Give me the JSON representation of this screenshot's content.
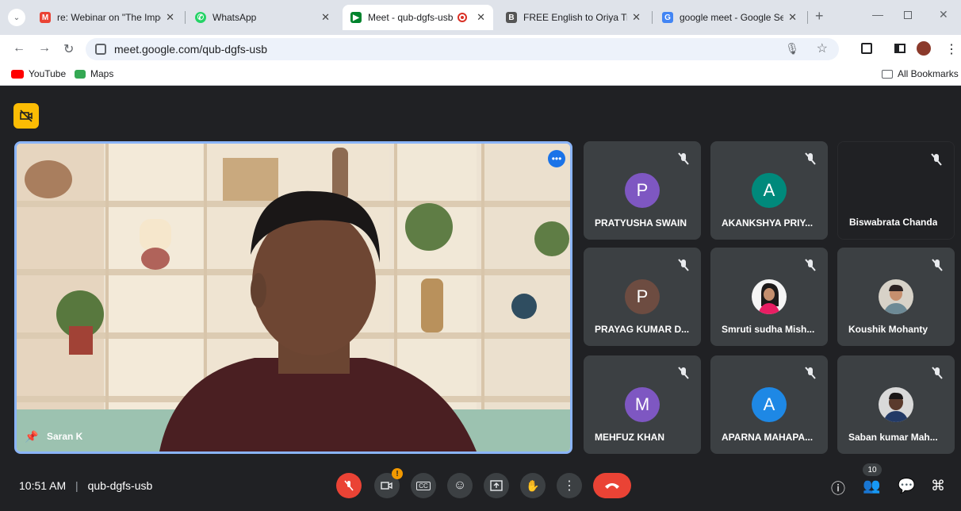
{
  "browser": {
    "tabs": [
      {
        "label": "re: Webinar on \"The Import",
        "color": "#ea4335",
        "glyph": "M"
      },
      {
        "label": "WhatsApp",
        "color": "#25d366",
        "glyph": "✆"
      },
      {
        "label": "Meet - qub-dgfs-usb",
        "color": "#00832d",
        "glyph": "▶"
      },
      {
        "label": "FREE English to Oriya Transl",
        "color": "#555555",
        "glyph": "B"
      },
      {
        "label": "google meet - Google Sear",
        "color": "#4285f4",
        "glyph": "G"
      }
    ],
    "url": "meet.google.com/qub-dgfs-usb",
    "bookmarks": [
      {
        "label": "YouTube",
        "color": "#ff0000"
      },
      {
        "label": "Maps",
        "color": "#34a853"
      }
    ],
    "all_bookmarks": "All Bookmarks"
  },
  "meeting": {
    "presenter_name": "Saran K",
    "time": "10:51 AM",
    "code": "qub-dgfs-usb",
    "participant_count": "10",
    "participants": [
      {
        "name": "PRATYUSHA SWAIN",
        "initial": "P",
        "color": "#7e57c2"
      },
      {
        "name": "AKANKSHYA PRIY...",
        "initial": "A",
        "color": "#00897b"
      },
      {
        "name": "Biswabrata Chanda",
        "initial": "",
        "color": ""
      },
      {
        "name": "PRAYAG KUMAR D...",
        "initial": "P",
        "color": "#6d4c41"
      },
      {
        "name": "Smruti sudha Mish...",
        "initial": "",
        "color": "photo"
      },
      {
        "name": "Koushik Mohanty",
        "initial": "",
        "color": "photo"
      },
      {
        "name": "MEHFUZ KHAN",
        "initial": "M",
        "color": "#7e57c2"
      },
      {
        "name": "APARNA MAHAPA...",
        "initial": "A",
        "color": "#1e88e5"
      },
      {
        "name": "Saban kumar Mah...",
        "initial": "",
        "color": "photo"
      }
    ]
  }
}
